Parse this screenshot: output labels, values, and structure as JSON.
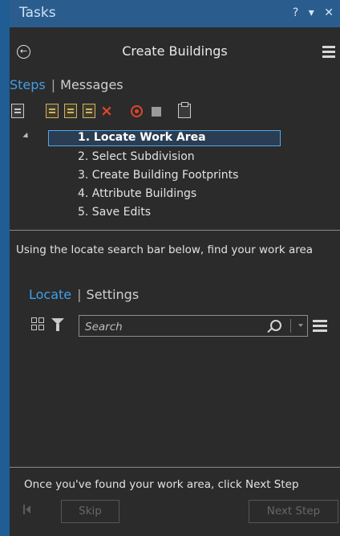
{
  "window": {
    "title": "Tasks",
    "help_label": "?",
    "dropdown_label": "▾",
    "close_label": "✕"
  },
  "header": {
    "title": "Create Buildings"
  },
  "tabs": {
    "active": "Steps",
    "inactive": "Messages"
  },
  "toolbar": {
    "icons": [
      "task-page-icon",
      "new-task-icon",
      "edit-task-icon",
      "new-step-icon",
      "delete-icon",
      "record-icon",
      "stop-icon",
      "clipboard-icon"
    ]
  },
  "steps": [
    {
      "label": "1.  Locate Work Area",
      "selected": true
    },
    {
      "label": "2.  Select Subdivision"
    },
    {
      "label": "3.  Create Building Footprints"
    },
    {
      "label": "4.  Attribute Buildings"
    },
    {
      "label": "5.  Save Edits"
    }
  ],
  "instruction": "Using the locate search bar below, find your work area",
  "locate": {
    "tabs": {
      "active": "Locate",
      "inactive": "Settings"
    },
    "search": {
      "placeholder": "Search",
      "value": ""
    }
  },
  "footer": {
    "text": "Once you've found your work area, click Next Step"
  },
  "buttons": {
    "skip": "Skip",
    "next": "Next Step"
  },
  "colors": {
    "accent": "#3fa0e8",
    "titlebar": "#2a5d8e",
    "panel": "#2b2b2b",
    "outer": "#1f5d94",
    "danger": "#e0452c"
  }
}
